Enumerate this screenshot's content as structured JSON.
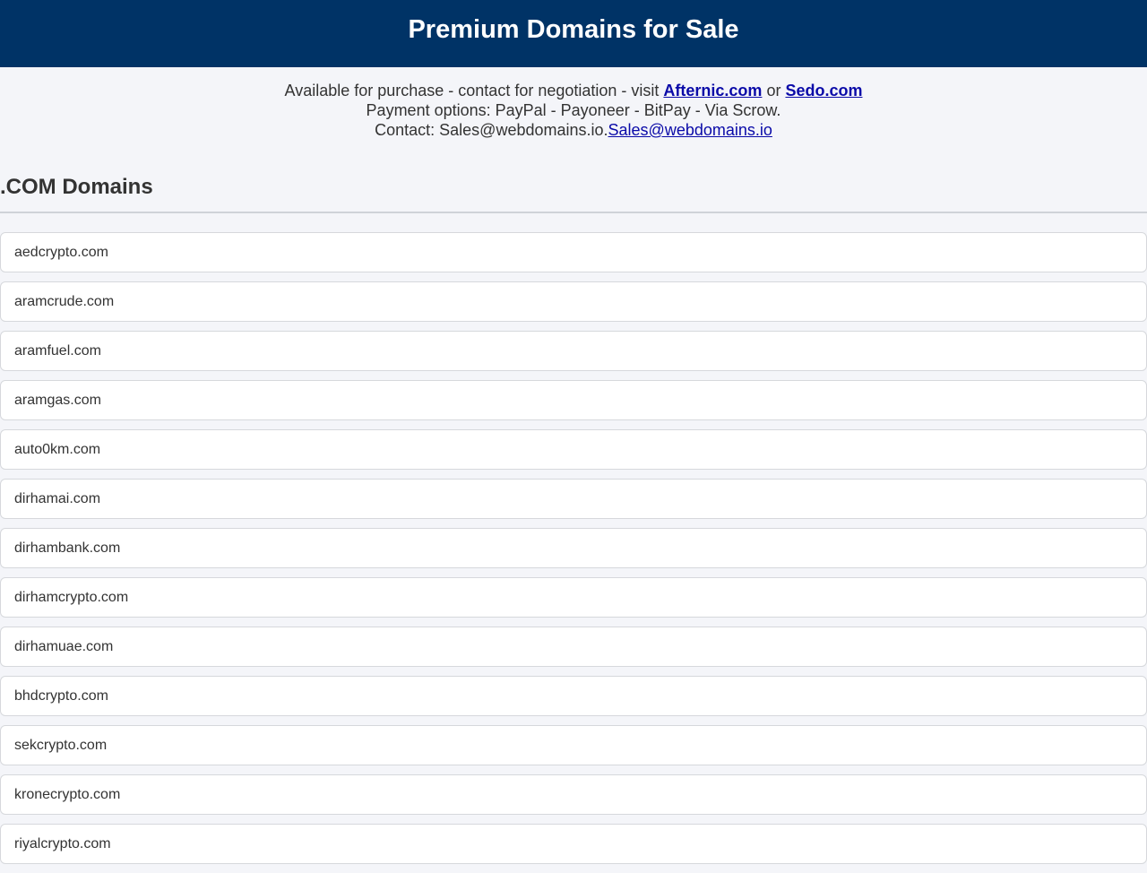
{
  "header": {
    "title": "Premium Domains for Sale"
  },
  "info": {
    "line1_prefix": "Available for purchase - contact for negotiation - visit ",
    "afternic_link": "Afternic.com",
    "line1_or": " or ",
    "sedo_link": "Sedo.com",
    "line2": "Payment options: PayPal - Payoneer - BitPay - Via Scrow.",
    "line3_prefix": "Contact: Sales@webdomains.io.",
    "email_link": "Sales@webdomains.io"
  },
  "section": {
    "title": ".COM Domains"
  },
  "domains": [
    "aedcrypto.com",
    "aramcrude.com",
    "aramfuel.com",
    "aramgas.com",
    "auto0km.com",
    "dirhamai.com",
    "dirhambank.com",
    "dirhamcrypto.com",
    "dirhamuae.com",
    "bhdcrypto.com",
    "sekcrypto.com",
    "kronecrypto.com",
    "riyalcrypto.com"
  ],
  "colors": {
    "header_bg": "#003366",
    "link": "#0a0aa8",
    "page_bg": "#f4f5f9"
  }
}
